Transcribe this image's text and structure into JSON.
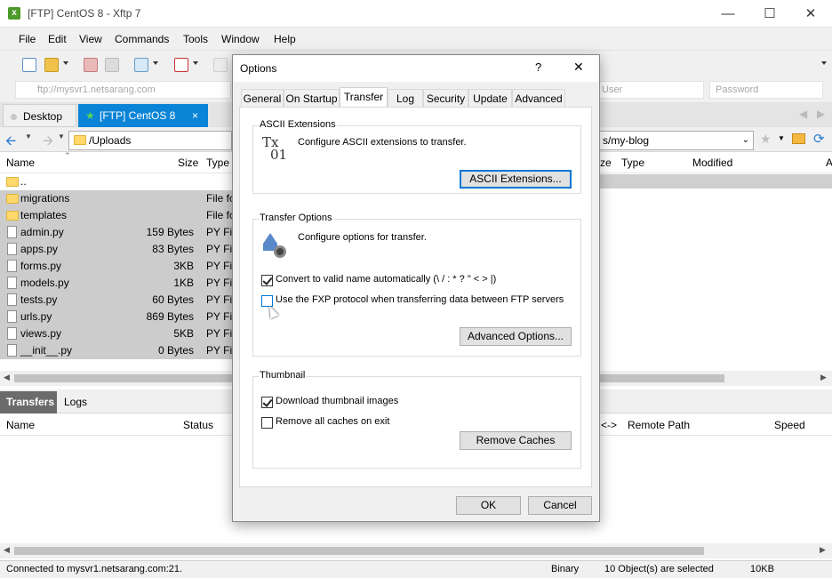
{
  "window": {
    "title": "[FTP] CentOS 8 - Xftp 7",
    "app_icon": "xftp-icon"
  },
  "menu": [
    "File",
    "Edit",
    "View",
    "Commands",
    "Tools",
    "Window",
    "Help"
  ],
  "address": {
    "host_placeholder": "ftp://mysvr1.netsarang.com",
    "user_placeholder": "User",
    "password_placeholder": "Password"
  },
  "tabs": [
    {
      "label": "Desktop",
      "active": false
    },
    {
      "label": "[FTP] CentOS 8",
      "active": true,
      "close": "×"
    }
  ],
  "local": {
    "path": "/Uploads",
    "columns": [
      "Name",
      "Size",
      "Type"
    ],
    "rows": [
      {
        "name": "..",
        "size": "",
        "type": "",
        "kind": "folder"
      },
      {
        "name": "migrations",
        "size": "",
        "type": "File fo",
        "kind": "folder"
      },
      {
        "name": "templates",
        "size": "",
        "type": "File fo",
        "kind": "folder"
      },
      {
        "name": "admin.py",
        "size": "159 Bytes",
        "type": "PY Fil",
        "kind": "file"
      },
      {
        "name": "apps.py",
        "size": "83 Bytes",
        "type": "PY Fil",
        "kind": "file"
      },
      {
        "name": "forms.py",
        "size": "3KB",
        "type": "PY Fil",
        "kind": "file"
      },
      {
        "name": "models.py",
        "size": "1KB",
        "type": "PY Fil",
        "kind": "file"
      },
      {
        "name": "tests.py",
        "size": "60 Bytes",
        "type": "PY Fil",
        "kind": "file"
      },
      {
        "name": "urls.py",
        "size": "869 Bytes",
        "type": "PY Fil",
        "kind": "file"
      },
      {
        "name": "views.py",
        "size": "5KB",
        "type": "PY Fil",
        "kind": "file"
      },
      {
        "name": "__init__.py",
        "size": "0 Bytes",
        "type": "PY Fil",
        "kind": "file"
      }
    ]
  },
  "remote": {
    "path_visible": "s/my-blog",
    "columns": [
      "ze",
      "Type",
      "Modified",
      "A"
    ]
  },
  "transfers": {
    "tabs": [
      "Transfers",
      "Logs"
    ],
    "columns": [
      "Name",
      "Status",
      "<->",
      "Remote Path",
      "Speed"
    ]
  },
  "status": {
    "connection": "Connected to mysvr1.netsarang.com:21.",
    "mode": "Binary",
    "selection": "10 Object(s) are selected",
    "size": "10KB"
  },
  "dialog": {
    "title": "Options",
    "help": "?",
    "close": "✕",
    "tabs": [
      "General",
      "On Startup",
      "Transfer",
      "Log",
      "Security",
      "Update",
      "Advanced"
    ],
    "active_tab": "Transfer",
    "ascii": {
      "group": "ASCII Extensions",
      "desc": "Configure ASCII extensions to transfer.",
      "button": "ASCII Extensions...",
      "icon_text_top": "Tx",
      "icon_text_bottom": "01"
    },
    "transfer": {
      "group": "Transfer Options",
      "desc": "Configure options for transfer.",
      "convert_label": "Convert to valid name automatically (\\ / : * ? \" < > |)",
      "convert_checked": true,
      "fxp_label": "Use the FXP protocol when transferring data between FTP servers",
      "fxp_checked": false,
      "button": "Advanced Options..."
    },
    "thumbnail": {
      "group": "Thumbnail",
      "download_label": "Download thumbnail images",
      "download_checked": true,
      "remove_label": "Remove all caches on exit",
      "remove_checked": false,
      "button": "Remove Caches"
    },
    "ok": "OK",
    "cancel": "Cancel"
  }
}
